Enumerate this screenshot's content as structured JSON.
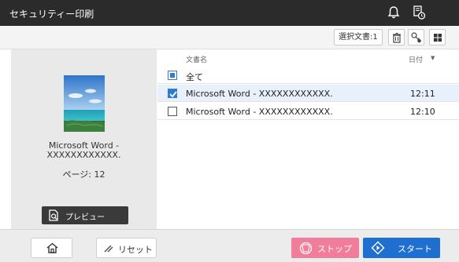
{
  "header": {
    "title": "セキュリティー印刷",
    "icons": [
      "bell-icon",
      "job-status-icon"
    ]
  },
  "toolbar": {
    "selected_count": "選択文書:1",
    "icons": [
      "trash-icon",
      "key-icon",
      "grid-view-icon"
    ]
  },
  "preview": {
    "doc_name_line1": "Microsoft Word -",
    "doc_name_line2": "XXXXXXXXXXXX.",
    "pages": "ページ: 12",
    "preview_label": "プレビュー"
  },
  "list": {
    "col_name": "文書名",
    "col_date": "日付",
    "sort_indicator": "▼",
    "select_all": "全て",
    "select_all_state": "partial",
    "rows": [
      {
        "name": "Microsoft Word - XXXXXXXXXXXX.",
        "time": "12:11",
        "checked": true
      },
      {
        "name": "Microsoft Word - XXXXXXXXXXXX.",
        "time": "12:10",
        "checked": false
      }
    ]
  },
  "footer": {
    "reset_label": "リセット",
    "stop_label": "ストップ",
    "start_label": "スタート"
  },
  "colors": {
    "titlebar": "#2b2b2b",
    "accent_blue": "#1f6fd1",
    "stop_pink": "#f07d9a",
    "selected_row": "#e8f1fb"
  }
}
